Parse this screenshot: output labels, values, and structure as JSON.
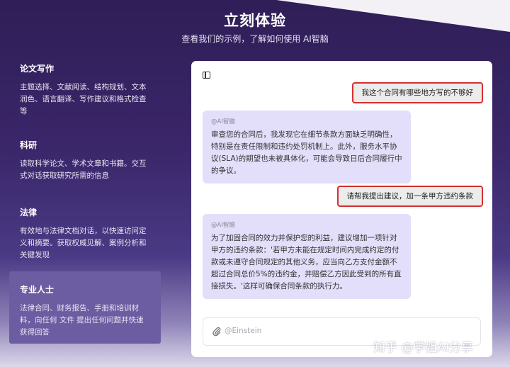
{
  "header": {
    "title": "立刻体验",
    "subtitle": "查看我们的示例，了解如何使用 AI智脑"
  },
  "features": [
    {
      "title": "论文写作",
      "desc": "主题选择、文献阅读、结构规划、文本润色、语言翻译、写作建议和格式检查等"
    },
    {
      "title": "科研",
      "desc": "读取科学论文、学术文章和书籍。交互式对话获取研究所需的信息"
    },
    {
      "title": "法律",
      "desc": "有效地与法律文档对话，以快速访问定义和摘要。获取权威见解、案例分析和关键发现"
    },
    {
      "title": "专业人士",
      "desc": "法律合同、财务报告、手册和培训材料，向任何 文件 提出任何问题并快速获得回答"
    }
  ],
  "chat": {
    "messages": [
      {
        "role": "user",
        "text": "我这个合同有哪些地方写的不够好"
      },
      {
        "role": "ai",
        "tag": "@AI智脑",
        "text": "审查您的合同后，我发现它在细节条款方面缺乏明确性，特别是在责任限制和违约处罚机制上。此外，服务水平协议(SLA)的期望也未被具体化，可能会导致日后合同履行中的争议。"
      },
      {
        "role": "user",
        "text": "请帮我提出建议，加一条甲方违约条款"
      },
      {
        "role": "ai",
        "tag": "@AI智脑",
        "text": "为了加固合同的效力并保护您的利益，建议增加一项针对甲方的违约条款：'若甲方未能在规定时间内完成约定的付款或未遵守合同规定的其他义务，应当向乙方支付金额不超过合同总价5%的违约金，并赔偿乙方因此受到的所有直接损失。'这样可确保合同条款的执行力。"
      }
    ],
    "input_placeholder": "@Einstein"
  },
  "watermark": "知乎 @学姐AI分享",
  "icons": [
    "sidebar-toggle-icon",
    "paperclip-icon"
  ],
  "colors": {
    "accent": "#6c5ca1",
    "highlight": "#d63030",
    "ai_bubble": "#e3defa"
  }
}
